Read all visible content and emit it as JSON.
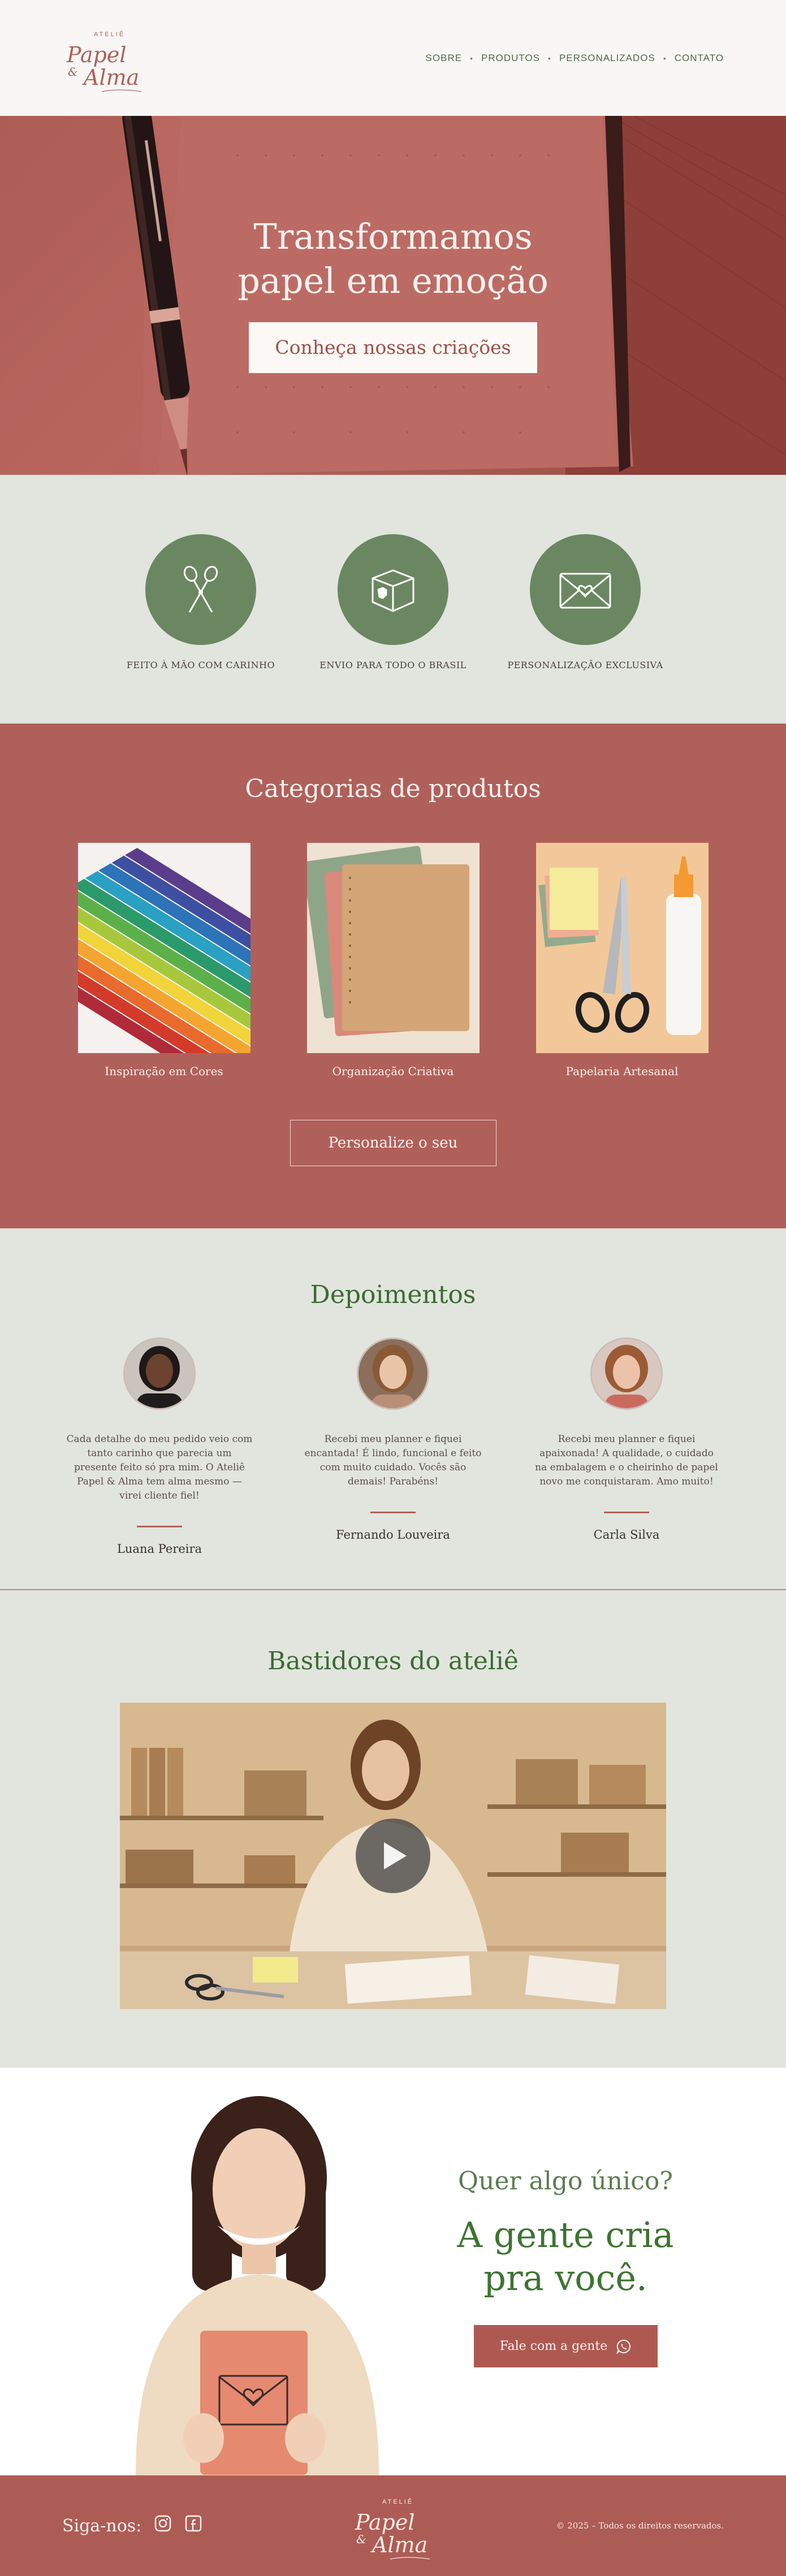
{
  "brand": {
    "top": "ATELIÊ",
    "word1": "Papel",
    "amp": "&",
    "word2": "Alma",
    "color": "#b0605a"
  },
  "nav": {
    "items": [
      "SOBRE",
      "PRODUTOS",
      "PERSONALIZADOS",
      "CONTATO"
    ],
    "separator": "•",
    "color": "#4f6b46"
  },
  "hero": {
    "title_line1": "Transformamos",
    "title_line2": "papel em emoção",
    "button": "Conheça nossas criações",
    "overlay_color": "#b0605a"
  },
  "features": [
    {
      "icon": "scissors-icon",
      "label": "FEITO À MÃO COM CARINHO"
    },
    {
      "icon": "box-icon",
      "label": "ENVIO PARA TODO O BRASIL"
    },
    {
      "icon": "envelope-heart-icon",
      "label": "PERSONALIZAÇÃO EXCLUSIVA"
    }
  ],
  "categories": {
    "title": "Categorias de produtos",
    "items": [
      {
        "caption": "Inspiração em Cores",
        "image": "colored-pencils"
      },
      {
        "caption": "Organização Criativa",
        "image": "notebooks"
      },
      {
        "caption": "Papelaria Artesanal",
        "image": "scissors-glue"
      }
    ],
    "button": "Personalize o seu"
  },
  "testimonials": {
    "title": "Depoimentos",
    "items": [
      {
        "quote": "Cada detalhe do meu pedido veio com tanto carinho que parecia um presente feito só pra mim. O Ateliê Papel & Alma tem alma mesmo — virei cliente fiel!",
        "name": "Luana Pereira"
      },
      {
        "quote": "Recebi meu planner e fiquei encantada! É lindo, funcional e feito com muito cuidado. Vocês são demais! Parabéns!",
        "name": "Fernando Louveira"
      },
      {
        "quote": "Recebi meu planner e fiquei apaixonada! A qualidade, o cuidado na embalagem e o cheirinho de papel novo me conquistaram. Amo muito!",
        "name": "Carla Silva"
      }
    ]
  },
  "backstage": {
    "title": "Bastidores do ateliê",
    "video_icon": "play-icon"
  },
  "cta": {
    "question": "Quer algo único?",
    "headline_line1": "A gente cria",
    "headline_line2": "pra você.",
    "button": "Fale com a gente",
    "button_icon": "whatsapp-icon"
  },
  "footer": {
    "follow": "Siga-nos:",
    "icons": [
      "instagram-icon",
      "facebook-icon"
    ],
    "copyright": "© 2025 – Todos os direitos reservados."
  }
}
